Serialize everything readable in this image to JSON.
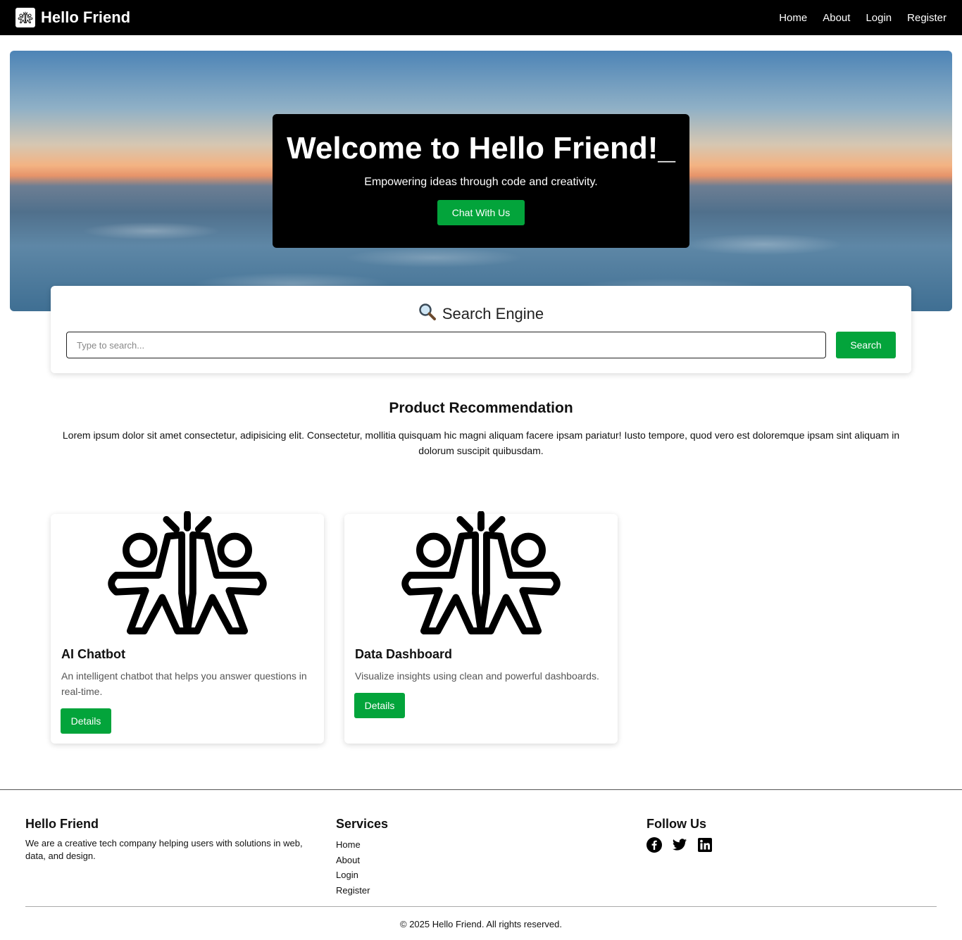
{
  "navbar": {
    "logo_icon": "people-high-five-icon",
    "brand": "Hello Friend",
    "links": [
      "Home",
      "About",
      "Login",
      "Register"
    ]
  },
  "hero": {
    "title": "Welcome to Hello Friend!_",
    "subtitle": "Empowering ideas through code and creativity.",
    "cta": "Chat With Us"
  },
  "search": {
    "icon": "magnifying-glass-icon",
    "title": "Search Engine",
    "placeholder": "Type to search...",
    "value": "",
    "button": "Search"
  },
  "products": {
    "title": "Product Recommendation",
    "description": "Lorem ipsum dolor sit amet consectetur, adipisicing elit. Consectetur, mollitia quisquam hic magni aliquam facere ipsam pariatur! Iusto tempore, quod vero est doloremque ipsam sint aliquam in dolorum suscipit quibusdam.",
    "cards": [
      {
        "icon": "people-high-five-icon",
        "title": "AI Chatbot",
        "description": "An intelligent chatbot that helps you answer questions in real-time.",
        "button": "Details"
      },
      {
        "icon": "people-high-five-icon",
        "title": "Data Dashboard",
        "description": "Visualize insights using clean and powerful dashboards.",
        "button": "Details"
      }
    ]
  },
  "footer": {
    "about": {
      "heading": "Hello Friend",
      "text": "We are a creative tech company helping users with solutions in web, data, and design."
    },
    "services": {
      "heading": "Services",
      "links": [
        "Home",
        "About",
        "Login",
        "Register"
      ]
    },
    "follow": {
      "heading": "Follow Us",
      "icons": [
        "facebook-icon",
        "twitter-icon",
        "linkedin-icon"
      ]
    },
    "copyright": "© 2025 Hello Friend. All rights reserved."
  },
  "colors": {
    "accent": "#03a43b",
    "navbar": "#000000"
  }
}
